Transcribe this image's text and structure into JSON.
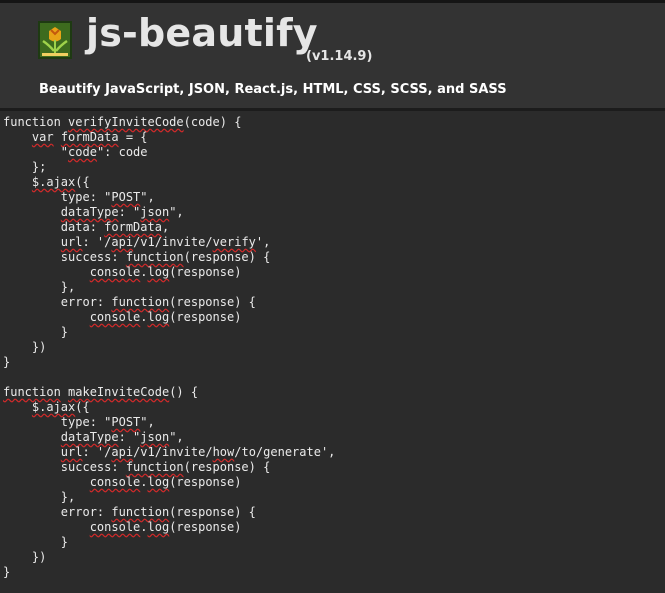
{
  "header": {
    "logo_icon": "tulip-logo-icon",
    "title": "js-beautify",
    "version": "(v1.14.9)",
    "subtitle": "Beautify JavaScript, JSON, React.js, HTML, CSS, SCSS, and SASS"
  },
  "colors": {
    "header_bg": "#333333",
    "editor_bg": "#2b2b2b",
    "text": "#eaeaea",
    "spellcheck_underline": "#d12a2a"
  },
  "code_lines": [
    [
      {
        "t": "function "
      },
      {
        "t": "verifyInviteCode",
        "s": 1
      },
      {
        "t": "(code) {"
      }
    ],
    [
      {
        "t": "    "
      },
      {
        "t": "var",
        "s": 1
      },
      {
        "t": " "
      },
      {
        "t": "formData",
        "s": 1
      },
      {
        "t": " = {"
      }
    ],
    [
      {
        "t": "        \""
      },
      {
        "t": "code",
        "s": 1
      },
      {
        "t": "\": code"
      }
    ],
    [
      {
        "t": "    };"
      }
    ],
    [
      {
        "t": "    "
      },
      {
        "t": "$.ajax",
        "s": 1
      },
      {
        "t": "({"
      }
    ],
    [
      {
        "t": "        type: \""
      },
      {
        "t": "POST",
        "s": 1
      },
      {
        "t": "\","
      }
    ],
    [
      {
        "t": "        "
      },
      {
        "t": "dataType",
        "s": 1
      },
      {
        "t": ": \""
      },
      {
        "t": "json",
        "s": 1
      },
      {
        "t": "\","
      }
    ],
    [
      {
        "t": "        data: "
      },
      {
        "t": "formData",
        "s": 1
      },
      {
        "t": ","
      }
    ],
    [
      {
        "t": "        "
      },
      {
        "t": "url",
        "s": 1
      },
      {
        "t": ": '/"
      },
      {
        "t": "api",
        "s": 1
      },
      {
        "t": "/v1/invite/"
      },
      {
        "t": "verify",
        "s": 1
      },
      {
        "t": "',"
      }
    ],
    [
      {
        "t": "        success: "
      },
      {
        "t": "function",
        "s": 1
      },
      {
        "t": "(response) {"
      }
    ],
    [
      {
        "t": "            "
      },
      {
        "t": "console",
        "s": 1
      },
      {
        "t": "."
      },
      {
        "t": "log",
        "s": 1
      },
      {
        "t": "(response)"
      }
    ],
    [
      {
        "t": "        },"
      }
    ],
    [
      {
        "t": "        error: "
      },
      {
        "t": "function",
        "s": 1
      },
      {
        "t": "(response) {"
      }
    ],
    [
      {
        "t": "            "
      },
      {
        "t": "console",
        "s": 1
      },
      {
        "t": "."
      },
      {
        "t": "log",
        "s": 1
      },
      {
        "t": "(response)"
      }
    ],
    [
      {
        "t": "        }"
      }
    ],
    [
      {
        "t": "    })"
      }
    ],
    [
      {
        "t": "}"
      }
    ],
    [
      {
        "t": ""
      }
    ],
    [
      {
        "t": "function",
        "s": 1
      },
      {
        "t": " "
      },
      {
        "t": "makeInviteCode",
        "s": 1
      },
      {
        "t": "() {"
      }
    ],
    [
      {
        "t": "    "
      },
      {
        "t": "$.ajax",
        "s": 1
      },
      {
        "t": "({"
      }
    ],
    [
      {
        "t": "        type: \""
      },
      {
        "t": "POST",
        "s": 1
      },
      {
        "t": "\","
      }
    ],
    [
      {
        "t": "        "
      },
      {
        "t": "dataType",
        "s": 1
      },
      {
        "t": ": \""
      },
      {
        "t": "json",
        "s": 1
      },
      {
        "t": "\","
      }
    ],
    [
      {
        "t": "        "
      },
      {
        "t": "url",
        "s": 1
      },
      {
        "t": ": '/"
      },
      {
        "t": "api",
        "s": 1
      },
      {
        "t": "/v1/invite/"
      },
      {
        "t": "how",
        "s": 1
      },
      {
        "t": "/to/generate',"
      }
    ],
    [
      {
        "t": "        success: "
      },
      {
        "t": "function",
        "s": 1
      },
      {
        "t": "(response) {"
      }
    ],
    [
      {
        "t": "            "
      },
      {
        "t": "console",
        "s": 1
      },
      {
        "t": "."
      },
      {
        "t": "log",
        "s": 1
      },
      {
        "t": "(response)"
      }
    ],
    [
      {
        "t": "        },"
      }
    ],
    [
      {
        "t": "        error: "
      },
      {
        "t": "function",
        "s": 1
      },
      {
        "t": "(response) {"
      }
    ],
    [
      {
        "t": "            "
      },
      {
        "t": "console",
        "s": 1
      },
      {
        "t": "."
      },
      {
        "t": "log",
        "s": 1
      },
      {
        "t": "(response)"
      }
    ],
    [
      {
        "t": "        }"
      }
    ],
    [
      {
        "t": "    })"
      }
    ],
    [
      {
        "t": "}"
      }
    ]
  ]
}
